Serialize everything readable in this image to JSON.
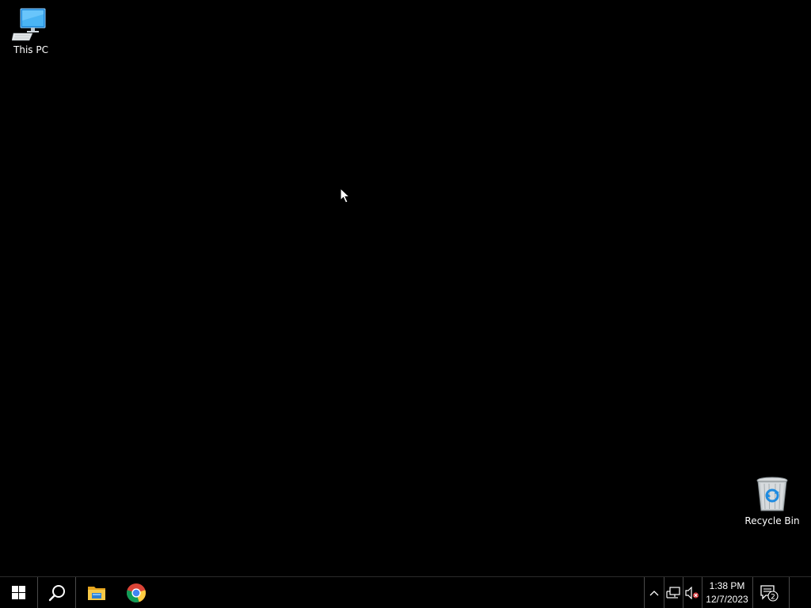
{
  "desktop": {
    "icons": [
      {
        "label": "This PC",
        "icon": "computer-icon"
      },
      {
        "label": "Recycle Bin",
        "icon": "recycle-bin-icon"
      }
    ],
    "background_color": "#000000"
  },
  "taskbar": {
    "start": {
      "icon": "windows-logo-icon"
    },
    "search": {
      "icon": "search-icon"
    },
    "pinned": [
      {
        "name": "File Explorer",
        "icon": "folder-icon"
      },
      {
        "name": "Google Chrome",
        "icon": "chrome-icon"
      }
    ],
    "tray": {
      "chevron_icon": "chevron-up-icon",
      "network_icon": "network-icon",
      "volume_icon": "volume-muted-icon",
      "time": "1:38 PM",
      "date": "12/7/2023",
      "notification_count": "2"
    }
  }
}
